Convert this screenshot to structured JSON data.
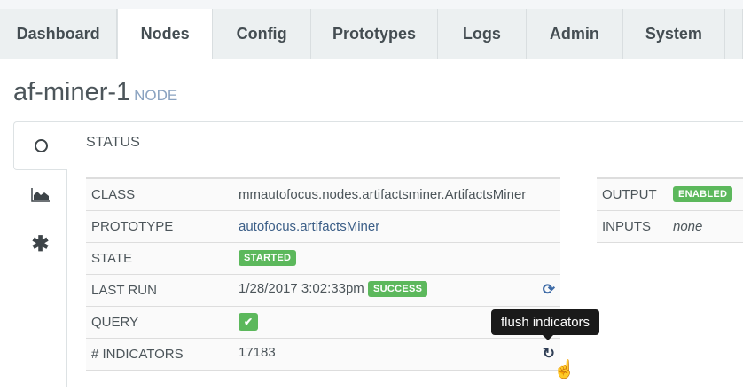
{
  "tabs": [
    "Dashboard",
    "Nodes",
    "Config",
    "Prototypes",
    "Logs",
    "Admin",
    "System"
  ],
  "title": "af-miner-1",
  "title_sub": "NODE",
  "section": "STATUS",
  "rows": [
    {
      "label": "CLASS",
      "value": "mmautofocus.nodes.artifactsminer.ArtifactsMiner"
    },
    {
      "label": "PROTOTYPE",
      "value": "autofocus.artifactsMiner"
    },
    {
      "label": "STATE",
      "badge": "STARTED"
    },
    {
      "label": "LAST RUN",
      "value": "1/28/2017 3:02:33pm",
      "badge": "SUCCESS"
    },
    {
      "label": "QUERY",
      "check": "✔"
    },
    {
      "label": "# INDICATORS",
      "value": "17183"
    }
  ],
  "side": [
    {
      "label": "OUTPUT",
      "badge": "ENABLED"
    },
    {
      "label": "INPUTS",
      "value": "none"
    }
  ],
  "tooltip": "flush indicators",
  "colors": {
    "success": "#5cb85c",
    "link": "#3b5e87"
  }
}
